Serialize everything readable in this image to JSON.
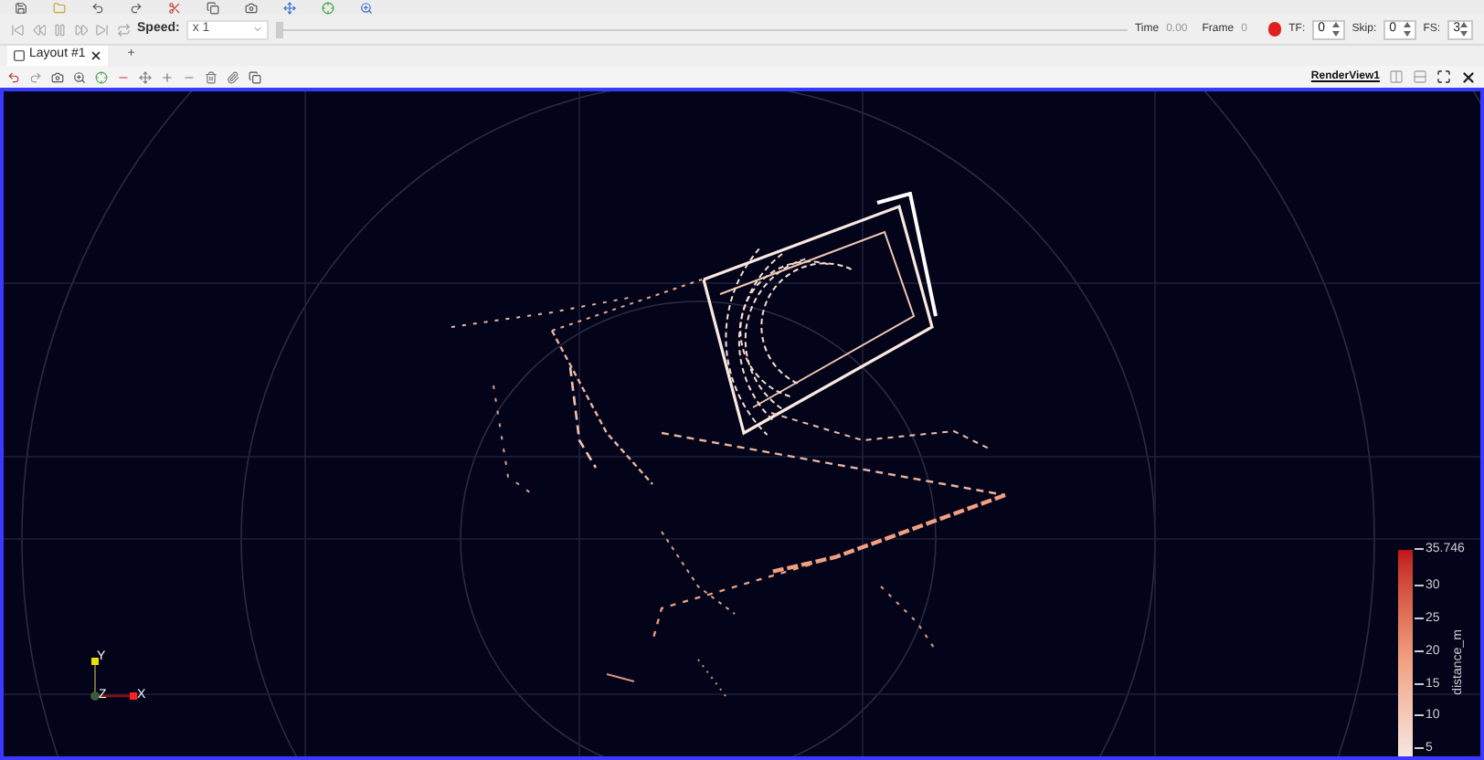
{
  "animation": {
    "speed_label": "Speed:",
    "speed_value": "x 1",
    "time_label": "Time",
    "time_value": "0.00",
    "frame_label": "Frame",
    "frame_value": "0",
    "tf_label": "TF:",
    "tf_value": "0",
    "skip_label": "Skip:",
    "skip_value": "0",
    "fs_label": "FS:",
    "fs_value": "3",
    "time_slider": {
      "level": 0
    }
  },
  "tabs": [
    {
      "label": "Layout #1",
      "selected": true
    },
    {
      "label": "+",
      "selected": false
    }
  ],
  "view": {
    "title": "RenderView1"
  },
  "color_legend": {
    "title": "distance_m",
    "max_label": "35.746",
    "ticks": [
      "30",
      "25",
      "20",
      "15",
      "10",
      "5"
    ]
  },
  "axes": {
    "labels": [
      "Y",
      "Z",
      "X"
    ]
  }
}
